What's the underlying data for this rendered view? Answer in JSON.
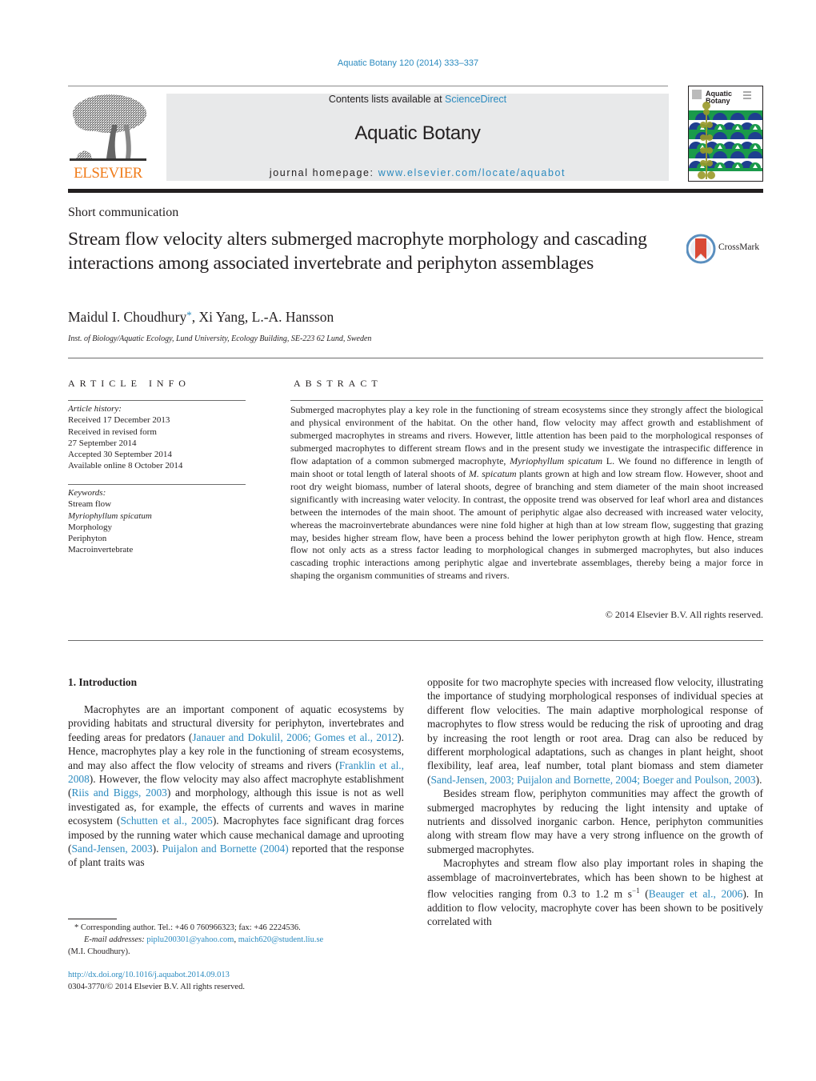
{
  "header": {
    "journal_reference": "Aquatic Botany 120 (2014) 333–337",
    "contents_prefix": "Contents lists available at ",
    "contents_link": "ScienceDirect",
    "journal_title": "Aquatic Botany",
    "homepage_prefix": "journal homepage: ",
    "homepage_link": "www.elsevier.com/locate/aquabot",
    "publisher_logo_text": "ELSEVIER",
    "cover_title_line1": "Aquatic",
    "cover_title_line2": "Botany",
    "colors": {
      "link": "#2a8abf",
      "elsevier_orange": "#f07c1b",
      "banner_bg": "#e8e9ea",
      "cover_green": "#1a9a4a",
      "cover_blue": "#1e3f8f",
      "cover_olive": "#9a9a2a",
      "crossmark_red": "#d94a35"
    }
  },
  "article": {
    "type": "Short communication",
    "title": "Stream flow velocity alters submerged macrophyte morphology and cascading interactions among associated invertebrate and periphyton assemblages",
    "crossmark_label": "CrossMark",
    "authors": [
      {
        "name": "Maidul I. Choudhury",
        "marker": "*"
      },
      {
        "name": "Xi Yang"
      },
      {
        "name": "L.-A. Hansson"
      }
    ],
    "author_sep": ", ",
    "affiliation": "Inst. of Biology/Aquatic Ecology, Lund University, Ecology Building, SE-223 62 Lund, Sweden"
  },
  "article_info": {
    "heading": "ARTICLE INFO",
    "history_label": "Article history:",
    "history": [
      "Received 17 December 2013",
      "Received in revised form",
      "27 September 2014",
      "Accepted 30 September 2014",
      "Available online 8 October 2014"
    ],
    "keywords_label": "Keywords:",
    "keywords": [
      {
        "text": "Stream flow",
        "italic": false
      },
      {
        "text": "Myriophyllum spicatum",
        "italic": true
      },
      {
        "text": "Morphology",
        "italic": false
      },
      {
        "text": "Periphyton",
        "italic": false
      },
      {
        "text": "Macroinvertebrate",
        "italic": false
      }
    ]
  },
  "abstract": {
    "heading": "ABSTRACT",
    "part1": "Submerged macrophytes play a key role in the functioning of stream ecosystems since they strongly affect the biological and physical environment of the habitat. On the other hand, flow velocity may affect growth and establishment of submerged macrophytes in streams and rivers. However, little attention has been paid to the morphological responses of submerged macrophytes to different stream flows and in the present study we investigate the intraspecific difference in flow adaptation of a common submerged macrophyte, ",
    "species1": "Myriophyllum spicatum",
    "part2": " L. We found no difference in length of main shoot or total length of lateral shoots of ",
    "species2": "M. spicatum",
    "part3": " plants grown at high and low stream flow. However, shoot and root dry weight biomass, number of lateral shoots, degree of branching and stem diameter of the main shoot increased significantly with increasing water velocity. In contrast, the opposite trend was observed for leaf whorl area and distances between the internodes of the main shoot. The amount of periphytic algae also decreased with increased water velocity, whereas the macroinvertebrate abundances were nine fold higher at high than at low stream flow, suggesting that grazing may, besides higher stream flow, have been a process behind the lower periphyton growth at high flow. Hence, stream flow not only acts as a stress factor leading to morphological changes in submerged macrophytes, but also induces cascading trophic interactions among periphytic algae and invertebrate assemblages, thereby being a major force in shaping the organism communities of streams and rivers.",
    "copyright": "© 2014 Elsevier B.V. All rights reserved."
  },
  "introduction": {
    "heading": "1.  Introduction",
    "left": {
      "p1": [
        {
          "t": "Macrophytes are an important component of aquatic ecosystems by providing habitats and structural diversity for periphyton, invertebrates and feeding areas for predators ("
        },
        {
          "t": "Janauer and Dokulil, 2006; Gomes et al., 2012",
          "link": true
        },
        {
          "t": "). Hence, macrophytes play a key role in the functioning of stream ecosystems, and may also affect the flow velocity of streams and rivers ("
        },
        {
          "t": "Franklin et al., 2008",
          "link": true
        },
        {
          "t": "). However, the flow velocity may also affect macrophyte establishment ("
        },
        {
          "t": "Riis and Biggs, 2003",
          "link": true
        },
        {
          "t": ") and morphology, although this issue is not as well investigated as, for example, the effects of currents and waves in marine ecosystem ("
        },
        {
          "t": "Schutten et al., 2005",
          "link": true
        },
        {
          "t": "). Macrophytes face significant drag forces imposed by the running water which cause mechanical damage and uprooting ("
        },
        {
          "t": "Sand-Jensen, 2003",
          "link": true
        },
        {
          "t": "). "
        },
        {
          "t": "Puijalon and Bornette (2004)",
          "link": true
        },
        {
          "t": " reported that the response of plant traits was"
        }
      ]
    },
    "right": {
      "p1": [
        {
          "t": "opposite for two macrophyte species with increased flow velocity, illustrating the importance of studying morphological responses of individual species at different flow velocities. The main adaptive morphological response of macrophytes to flow stress would be reducing the risk of uprooting and drag by increasing the root length or root area. Drag can also be reduced by different morphological adaptations, such as changes in plant height, shoot flexibility, leaf area, leaf number, total plant biomass and stem diameter ("
        },
        {
          "t": "Sand-Jensen, 2003; Puijalon and Bornette, 2004; Boeger and Poulson, 2003",
          "link": true
        },
        {
          "t": ")."
        }
      ],
      "p2": [
        {
          "t": "Besides stream flow, periphyton communities may affect the growth of submerged macrophytes by reducing the light intensity and uptake of nutrients and dissolved inorganic carbon. Hence, periphyton communities along with stream flow may have a very strong influence on the growth of submerged macrophytes."
        }
      ],
      "p3": [
        {
          "t": "Macrophytes and stream flow also play important roles in shaping the assemblage of macroinvertebrates, which has been shown to be highest at flow velocities ranging from 0.3 to 1.2 m s"
        },
        {
          "t": "−1",
          "sup": true
        },
        {
          "t": " ("
        },
        {
          "t": "Beauger et al., 2006",
          "link": true
        },
        {
          "t": "). In addition to flow velocity, macrophyte cover has been shown to be positively correlated with"
        }
      ]
    }
  },
  "footnote": {
    "marker": "*",
    "corresponding": " Corresponding author. Tel.: +46 0 760966323; fax: +46 2224536.",
    "email_label": "E-mail addresses:",
    "email1": "piplu200301@yahoo.com",
    "email_sep": ", ",
    "email2": "maich620@student.liu.se",
    "email_owner": "(M.I. Choudhury).",
    "doi": "http://dx.doi.org/10.1016/j.aquabot.2014.09.013",
    "issn_copyright": "0304-3770/© 2014 Elsevier B.V. All rights reserved."
  }
}
